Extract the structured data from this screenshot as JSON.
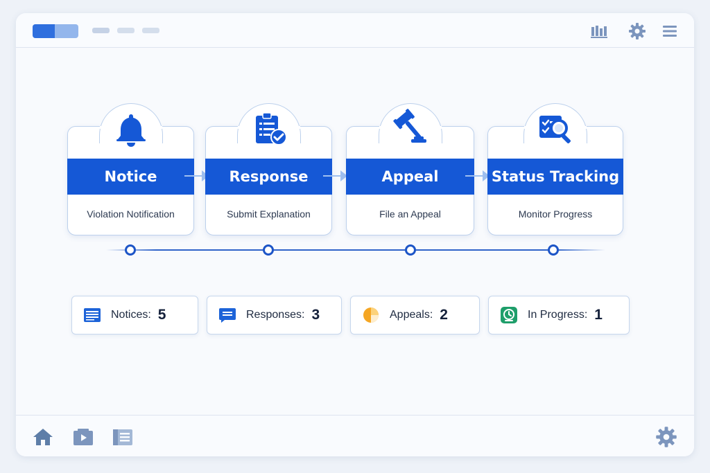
{
  "topbar": {
    "icons": [
      "bar-chart-icon",
      "gear-icon",
      "menu-icon"
    ]
  },
  "steps": [
    {
      "title": "Notice",
      "subtitle": "Violation Notification",
      "icon": "bell-icon"
    },
    {
      "title": "Response",
      "subtitle": "Submit Explanation",
      "icon": "clipboard-check-icon"
    },
    {
      "title": "Appeal",
      "subtitle": "File an Appeal",
      "icon": "gavel-icon"
    },
    {
      "title": "Status Tracking",
      "subtitle": "Monitor Progress",
      "icon": "magnifier-checklist-icon"
    }
  ],
  "stats": [
    {
      "label": "Notices:",
      "value": "5",
      "icon": "document-icon"
    },
    {
      "label": "Responses:",
      "value": "3",
      "icon": "chat-icon"
    },
    {
      "label": "Appeals:",
      "value": "2",
      "icon": "pie-icon"
    },
    {
      "label": "In Progress:",
      "value": "1",
      "icon": "clock-icon"
    }
  ],
  "bottombar": {
    "icons": [
      "home-icon",
      "video-icon",
      "notebook-icon",
      "gear-icon"
    ]
  },
  "colors": {
    "accent": "#1558d6",
    "accent_light": "#93b6ec",
    "stat_orange": "#f5a623",
    "stat_green": "#1e9e6a"
  }
}
